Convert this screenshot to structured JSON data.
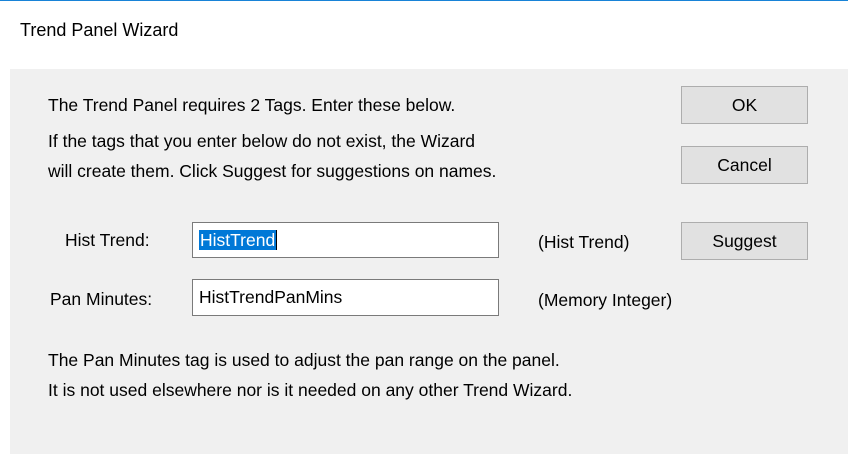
{
  "window": {
    "title": "Trend Panel Wizard"
  },
  "intro": {
    "line1": "The Trend Panel requires 2 Tags.  Enter these below.",
    "line2": "If the tags that you enter below do not exist, the Wizard",
    "line3": "will create them.  Click Suggest for suggestions on names."
  },
  "buttons": {
    "ok": "OK",
    "cancel": "Cancel",
    "suggest": "Suggest"
  },
  "fields": {
    "hist_trend": {
      "label": "Hist Trend:",
      "value": "HistTrend",
      "type_hint": "(Hist Trend)"
    },
    "pan_minutes": {
      "label": "Pan Minutes:",
      "value": "HistTrendPanMins",
      "type_hint": "(Memory Integer)"
    }
  },
  "footer": {
    "line1": "The Pan Minutes tag is used to adjust the pan range on the panel.",
    "line2": "It is not used elsewhere nor is it needed on any other Trend Wizard."
  },
  "colors": {
    "title_accent": "#1883d7",
    "dialog_background": "#f0f0f0",
    "selection": "#0078d7"
  }
}
